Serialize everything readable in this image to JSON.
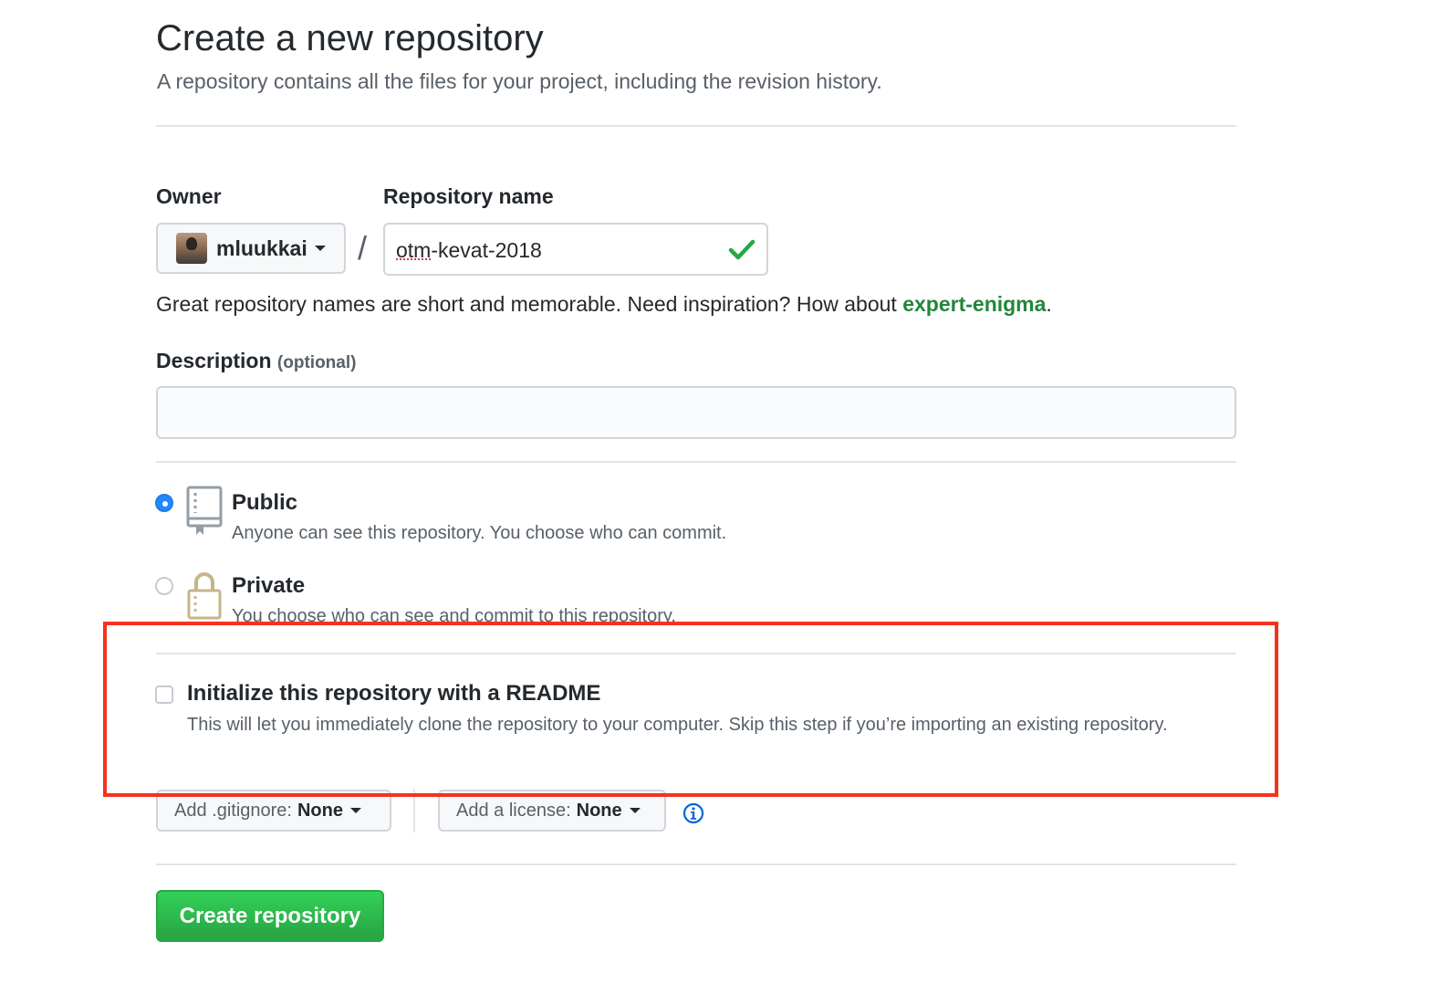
{
  "page": {
    "title": "Create a new repository",
    "subtitle": "A repository contains all the files for your project, including the revision history."
  },
  "owner": {
    "label": "Owner",
    "value": "mluukkai"
  },
  "separator": "/",
  "repository_name": {
    "label": "Repository name",
    "value_underlined": "otm",
    "value_rest": "-kevat-2018",
    "valid": true
  },
  "name_hint": {
    "text": "Great repository names are short and memorable. Need inspiration? How about ",
    "suggestion": "expert-enigma",
    "suffix": "."
  },
  "description": {
    "label": "Description",
    "optional_label": "(optional)",
    "value": ""
  },
  "visibility": {
    "selected": "Public",
    "options": [
      {
        "title": "Public",
        "description": "Anyone can see this repository. You choose who can commit."
      },
      {
        "title": "Private",
        "description": "You choose who can see and commit to this repository."
      }
    ]
  },
  "readme": {
    "checked": false,
    "title": "Initialize this repository with a README",
    "description": "This will let you immediately clone the repository to your computer. Skip this step if you’re importing an existing repository."
  },
  "gitignore": {
    "label": "Add .gitignore:",
    "value": "None"
  },
  "license": {
    "label": "Add a license:",
    "value": "None"
  },
  "submit": {
    "label": "Create repository"
  },
  "colors": {
    "primary_button": "#28a745",
    "link_green": "#22863a",
    "radio_selected": "#2188ff",
    "highlight_box": "#f5321e",
    "info_icon": "#0366d6"
  }
}
